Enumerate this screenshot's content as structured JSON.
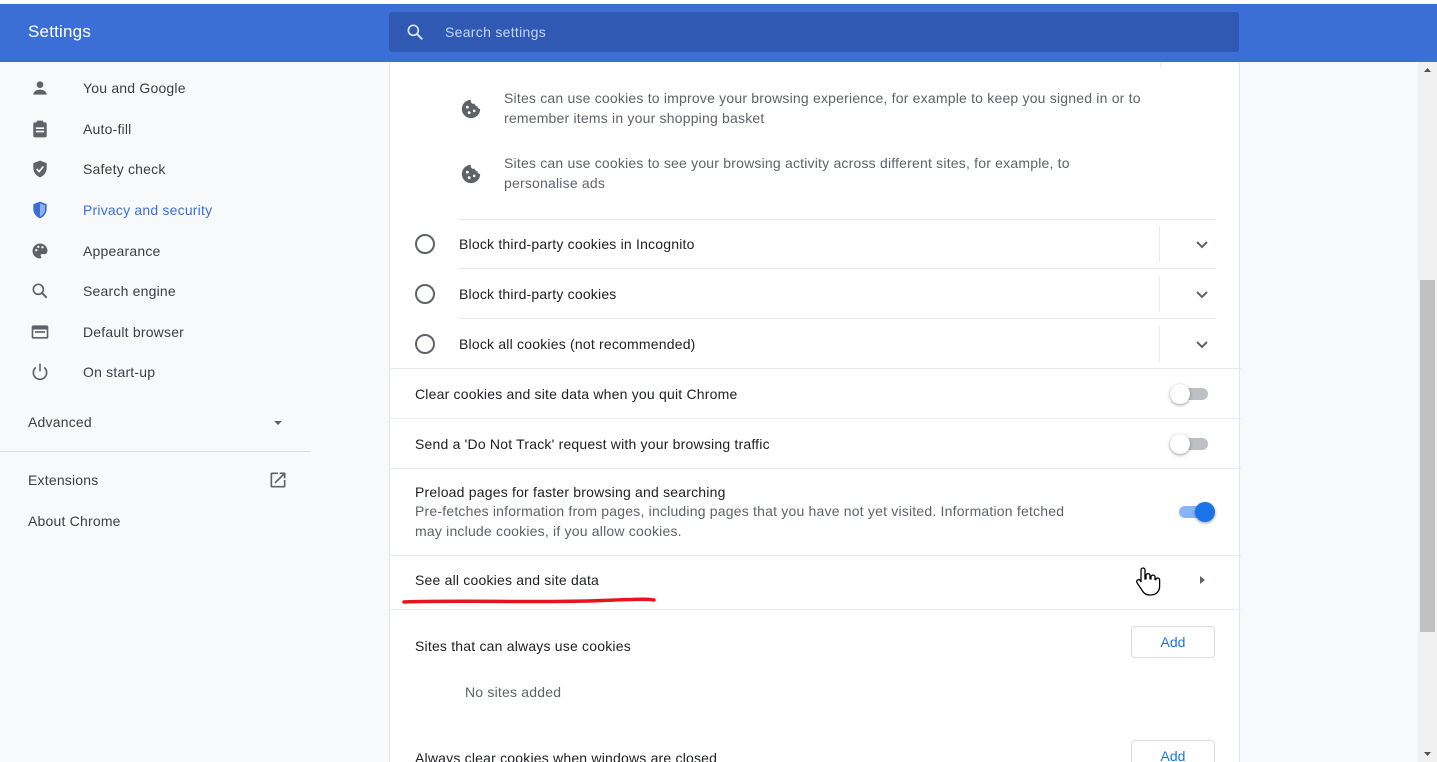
{
  "header": {
    "title": "Settings",
    "search_placeholder": "Search settings"
  },
  "sidebar": {
    "items": [
      {
        "label": "You and Google",
        "icon": "person-icon"
      },
      {
        "label": "Auto-fill",
        "icon": "clipboard-icon"
      },
      {
        "label": "Safety check",
        "icon": "shield-check-icon"
      },
      {
        "label": "Privacy and security",
        "icon": "shield-icon",
        "active": true
      },
      {
        "label": "Appearance",
        "icon": "palette-icon"
      },
      {
        "label": "Search engine",
        "icon": "search-icon"
      },
      {
        "label": "Default browser",
        "icon": "browser-icon"
      },
      {
        "label": "On start-up",
        "icon": "power-icon"
      }
    ],
    "advanced_label": "Advanced",
    "extensions_label": "Extensions",
    "about_label": "About Chrome"
  },
  "main": {
    "cookie_info": [
      {
        "line1": "Sites can use cookies to improve your browsing experience, for example to keep you signed in or to",
        "line2": "remember items in your shopping basket"
      },
      {
        "line1": "Sites can use cookies to see your browsing activity across different sites, for example, to",
        "line2": "personalise ads"
      }
    ],
    "radio_options": [
      "Block third-party cookies in Incognito",
      "Block third-party cookies",
      "Block all cookies (not recommended)"
    ],
    "clear_on_quit_label": "Clear cookies and site data when you quit Chrome",
    "clear_on_quit_enabled": false,
    "do_not_track_label": "Send a 'Do Not Track' request with your browsing traffic",
    "do_not_track_enabled": false,
    "preload": {
      "label": "Preload pages for faster browsing and searching",
      "desc_line1": "Pre-fetches information from pages, including pages that you have not yet visited. Information fetched",
      "desc_line2": "may include cookies, if you allow cookies.",
      "enabled": true
    },
    "see_all_label": "See all cookies and site data",
    "always_allow": {
      "label": "Sites that can always use cookies",
      "add_label": "Add",
      "empty_label": "No sites added"
    },
    "always_clear": {
      "label": "Always clear cookies when windows are closed",
      "add_label": "Add"
    }
  },
  "colors": {
    "header_bg": "#3c6fd6",
    "accent": "#1a73e8",
    "annotation": "#e8141b"
  }
}
